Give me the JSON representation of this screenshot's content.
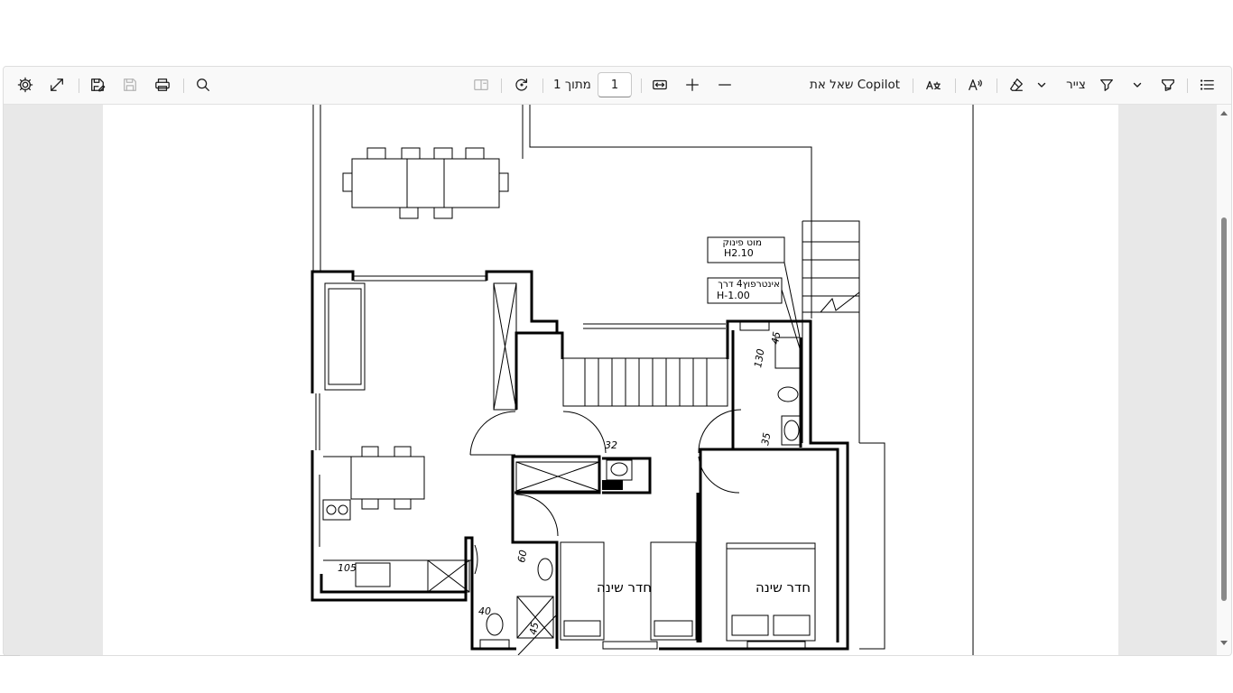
{
  "toolbar": {
    "settings_icon": "gear-icon",
    "fullscreen_icon": "expand-icon",
    "save_as_icon": "save-as-icon",
    "save_icon": "save-icon",
    "print_icon": "printer-icon",
    "search_icon": "search-icon",
    "page_view_icon": "page-view-icon",
    "rotate_icon": "rotate-icon",
    "page_total": "מתוך 1",
    "page_number": "1",
    "fit_icon": "fit-width-icon",
    "zoom_in_icon": "plus-icon",
    "zoom_out_icon": "minus-icon",
    "copilot_label": "שאל את Copilot",
    "translate_icon": "translate-icon",
    "read_aloud_icon": "read-aloud-icon",
    "erase_icon": "eraser-icon",
    "draw_label": "צייר",
    "draw_icon": "pen-icon",
    "highlight_icon": "highlighter-icon",
    "contents_icon": "contents-list-icon"
  },
  "drawing": {
    "note1_line1": "מוט פינוק",
    "note1_line2": "H2.10",
    "note2_line1": "אינטרפוץ4 דרך",
    "note2_line2": "H-1.00",
    "room1": "חדר שינה",
    "room2": "חדר שינה",
    "dim_45a": "45",
    "dim_130": "130",
    "dim_35": "35",
    "dim_32": "32",
    "dim_60": "60",
    "dim_105": "105",
    "dim_40": "40",
    "dim_45b": "45"
  }
}
